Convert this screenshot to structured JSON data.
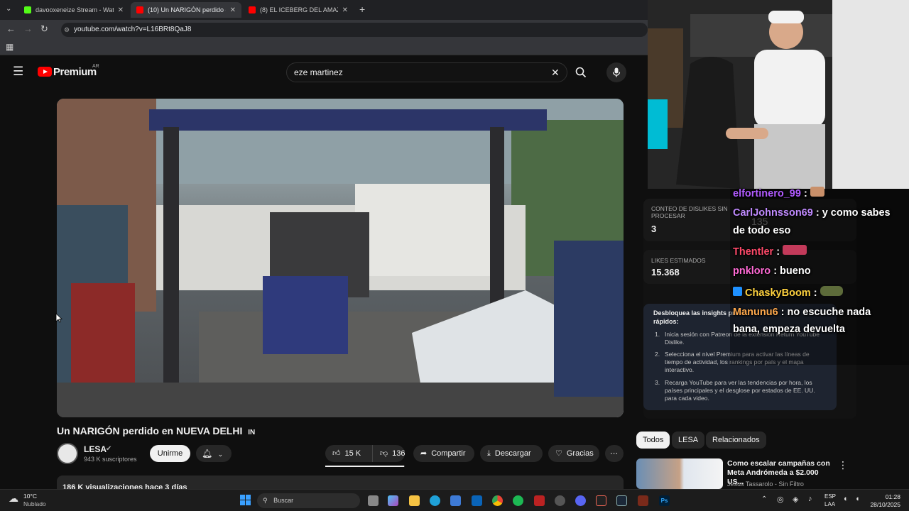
{
  "browser": {
    "tabs": [
      {
        "title": "davooxeneize Stream - Watch Live",
        "favicon_color": "#53fc18",
        "active": false
      },
      {
        "title": "(10) Un NARIGÓN perdido en NUEVA DELHI",
        "favicon_color": "#ff0000",
        "active": true
      },
      {
        "title": "(8) EL ICEBERG DEL AMAZONAS",
        "favicon_color": "#ff0000",
        "active": false
      }
    ],
    "url": "youtube.com/watch?v=L16BRt8QaJ8"
  },
  "youtube": {
    "logo_text": "Premium",
    "logo_badge": "AR",
    "search_value": "eze martinez",
    "video": {
      "title": "Un NARIGÓN perdido en NUEVA DELHI",
      "title_badge": "IN",
      "channel": "LESA",
      "subscribers": "943 K suscriptores",
      "join_label": "Unirme",
      "likes": "15 K",
      "dislikes": "136",
      "share_label": "Compartir",
      "download_label": "Descargar",
      "thanks_label": "Gracias",
      "views_line": "186 K visualizaciones  hace 3 días"
    },
    "extension": {
      "dislikes_label": "CONTEO DE DISLIKES SIN PROCESAR",
      "dislikes_value": "3",
      "likes_label": "LIKES ESTIMADOS",
      "likes_value": "15.368",
      "unlock_title": "Desbloquea las insights pro",
      "unlock_subtitle": "rápidos:",
      "steps": [
        "Inicia sesión con Patreon de la extensión Return YouTube Dislike.",
        "Selecciona el nivel Premium para activar las líneas de tiempo de actividad, los rankings por país y el mapa interactivo.",
        "Recarga YouTube para ver las tendencias por hora, los países principales y el desglose por estados de EE. UU. para cada video."
      ]
    },
    "chips": [
      "Todos",
      "LESA",
      "Relacionados"
    ],
    "recommended": {
      "title": "Como escalar campañas con Meta Andrómeda a $2.000 US...",
      "channel": "Jesus Tassarolo - Sin Filtro"
    }
  },
  "stream_chat": [
    {
      "user": "elfortinero_99",
      "msg": ":",
      "color": "#b15bff"
    },
    {
      "user": "CarlJohnsson69",
      "msg": ": y como sabes",
      "color": "#c08bff"
    },
    {
      "user": "",
      "msg": "de todo eso",
      "color": "#ffffff"
    },
    {
      "user": "Thentler",
      "msg": ":",
      "color": "#ff4a6a"
    },
    {
      "user": "pnkloro",
      "msg": ": bueno",
      "color": "#ff6ad5"
    },
    {
      "user": "ChaskyBoom",
      "msg": ":",
      "color": "#ffd23f"
    },
    {
      "user": "Manunu6",
      "msg": ": no escuche nada",
      "color": "#ffa94d"
    },
    {
      "user": "",
      "msg": "bana, empeza devuelta",
      "color": "#ffffff"
    }
  ],
  "stream_cam_counter": "135",
  "taskbar": {
    "weather_temp": "10°C",
    "weather_desc": "Nublado",
    "search_placeholder": "Buscar",
    "lang": "ESP",
    "lang_sub": "LAA",
    "time": "01:28",
    "date": "28/10/2025"
  }
}
